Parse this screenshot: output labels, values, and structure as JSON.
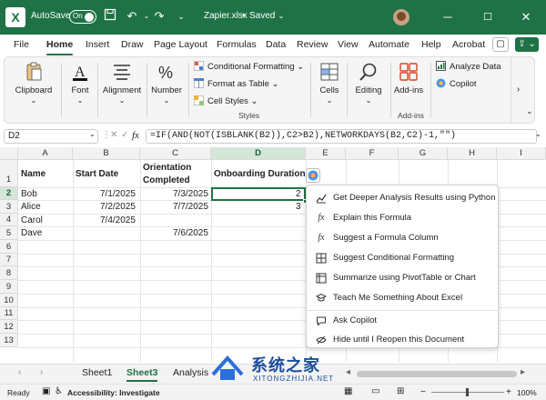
{
  "titlebar": {
    "autosave_label": "AutoSave",
    "autosave_state": "On",
    "filename": "Zapier.xlsx",
    "saved_state": "Saved",
    "separator": "•"
  },
  "tabs": [
    "File",
    "Home",
    "Insert",
    "Draw",
    "Page Layout",
    "Formulas",
    "Data",
    "Review",
    "View",
    "Automate",
    "Help",
    "Acrobat"
  ],
  "active_tab": "Home",
  "ribbon": {
    "clipboard": "Clipboard",
    "font": "Font",
    "alignment": "Alignment",
    "number": "Number",
    "conditional_formatting": "Conditional Formatting",
    "format_as_table": "Format as Table",
    "cell_styles": "Cell Styles",
    "styles_group": "Styles",
    "cells": "Cells",
    "editing": "Editing",
    "addins": "Add-ins",
    "analyze_data": "Analyze Data",
    "copilot": "Copilot",
    "addins_group": "Add-ins"
  },
  "formula_bar": {
    "name_box": "D2",
    "fx_label": "fx",
    "formula": "=IF(AND(NOT(ISBLANK(B2)),C2>B2),NETWORKDAYS(B2,C2)-1,\"\")"
  },
  "columns": [
    "A",
    "B",
    "C",
    "D",
    "E",
    "F",
    "G",
    "H",
    "I"
  ],
  "rows": [
    "1",
    "2",
    "3",
    "4",
    "5",
    "6",
    "7",
    "8",
    "9",
    "10",
    "11",
    "12",
    "13"
  ],
  "sheet": {
    "headers": {
      "a": "Name",
      "b": "Start Date",
      "c1": "Orientation",
      "c2": "Completed",
      "d": "Onboarding Duration"
    },
    "data": [
      {
        "name": "Bob",
        "start": "7/1/2025",
        "orient": "7/3/2025",
        "dur": "2"
      },
      {
        "name": "Alice",
        "start": "7/2/2025",
        "orient": "7/7/2025",
        "dur": "3"
      },
      {
        "name": "Carol",
        "start": "7/4/2025",
        "orient": "",
        "dur": ""
      },
      {
        "name": "Dave",
        "start": "",
        "orient": "7/6/2025",
        "dur": ""
      }
    ]
  },
  "copilot_menu": {
    "items": [
      {
        "label": "Get Deeper Analysis Results using Python",
        "icon": "chart-python-icon"
      },
      {
        "label": "Explain this Formula",
        "icon": "fx-icon"
      },
      {
        "label": "Suggest a Formula Column",
        "icon": "fx-column-icon"
      },
      {
        "label": "Suggest Conditional Formatting",
        "icon": "conditional-format-icon"
      },
      {
        "label": "Summarize using PivotTable or Chart",
        "icon": "pivot-icon"
      },
      {
        "label": "Teach Me Something About Excel",
        "icon": "graduation-cap-icon"
      },
      {
        "label": "Ask Copilot",
        "icon": "chat-icon"
      },
      {
        "label": "Hide until I Reopen this Document",
        "icon": "eye-off-icon"
      }
    ]
  },
  "sheet_tabs": [
    "Sheet1",
    "Sheet3",
    "Analysis"
  ],
  "active_sheet": "Sheet3",
  "status": {
    "ready": "Ready",
    "accessibility": "Accessibility: Investigate",
    "zoom": "100%"
  },
  "watermark": {
    "cn": "系统之家",
    "en": "XITONGZHIJIA.NET"
  },
  "colors": {
    "brand": "#1f7246",
    "selection": "#1f7246",
    "header_selected": "#d3e6d8"
  }
}
